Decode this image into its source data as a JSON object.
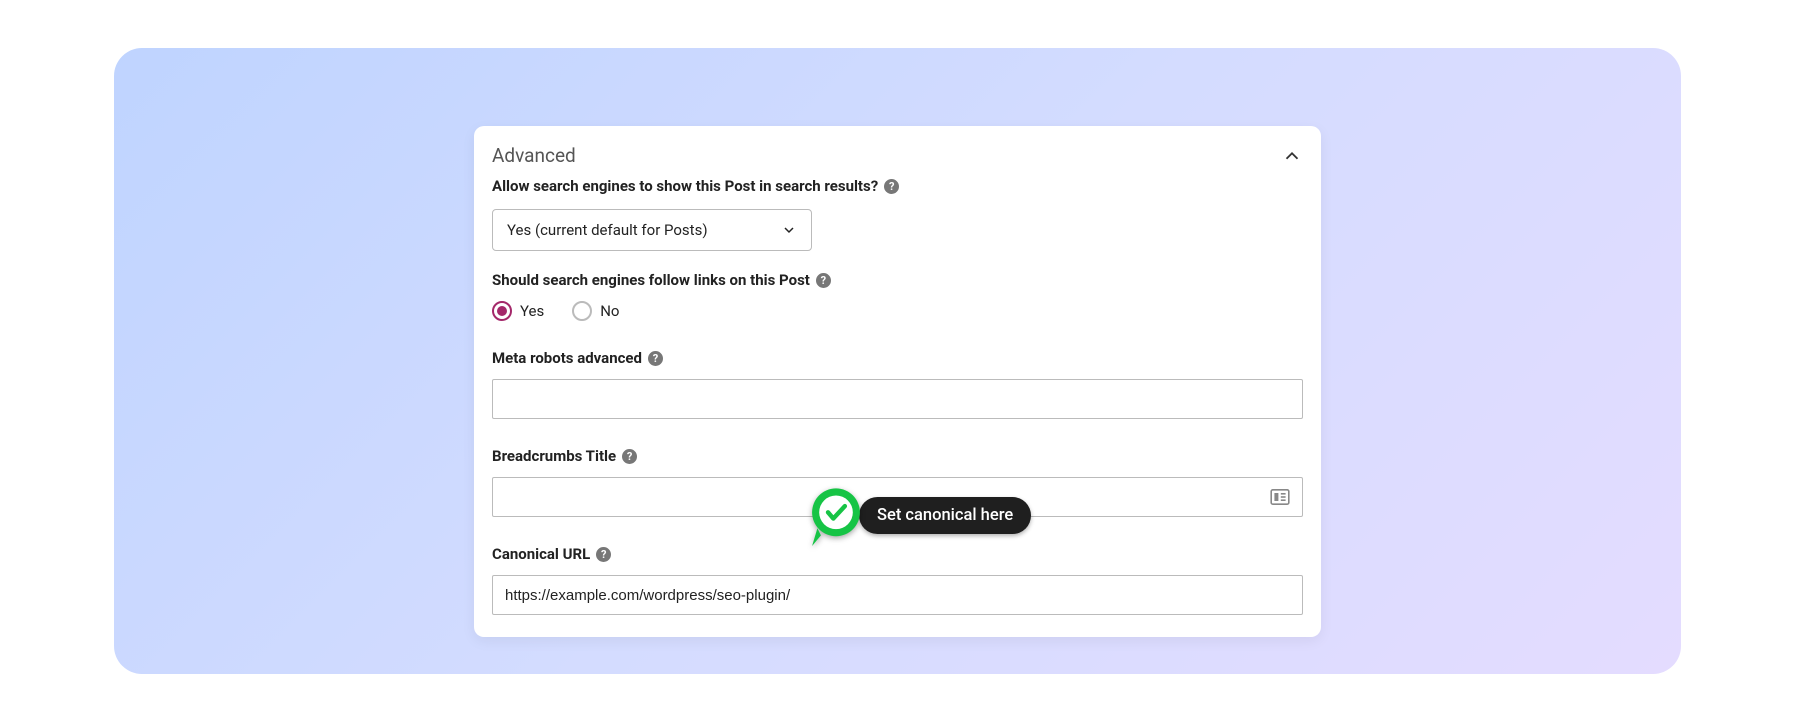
{
  "panel": {
    "title": "Advanced"
  },
  "allowSearch": {
    "label": "Allow search engines to show this Post in search results?",
    "selected": "Yes (current default for Posts)"
  },
  "followLinks": {
    "label": "Should search engines follow links on this Post",
    "yes": "Yes",
    "no": "No"
  },
  "metaRobots": {
    "label": "Meta robots advanced",
    "value": ""
  },
  "breadcrumbs": {
    "label": "Breadcrumbs Title",
    "value": ""
  },
  "canonical": {
    "label": "Canonical URL",
    "value": "https://example.com/wordpress/seo-plugin/"
  },
  "annotation": {
    "text": "Set canonical here"
  },
  "help": "?"
}
